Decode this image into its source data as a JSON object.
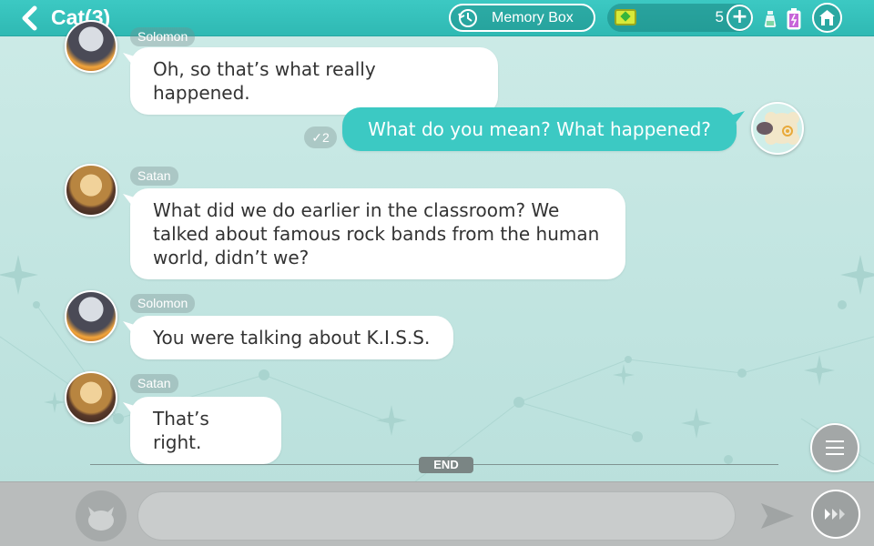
{
  "header": {
    "title": "Cat(3)",
    "memory_box_label": "Memory Box",
    "currency_count": "5",
    "plus_label": "+"
  },
  "messages": [
    {
      "sender": "Solomon",
      "text": "Oh, so that’s what really happened.",
      "side": "left"
    },
    {
      "sender": "",
      "text": "What do you mean? What happened?",
      "side": "right",
      "read_count": "✓2"
    },
    {
      "sender": "Satan",
      "text": "What did we do earlier in the classroom? We talked about famous rock bands from the human world, didn’t we?",
      "side": "left"
    },
    {
      "sender": "Solomon",
      "text": "You were talking about K.I.S.S.",
      "side": "left"
    },
    {
      "sender": "Satan",
      "text": "That’s right.",
      "side": "left"
    }
  ],
  "end_label": "END",
  "input": {
    "value": "",
    "placeholder": ""
  },
  "colors": {
    "accent": "#3cc9c3",
    "bubble_text": "#333333",
    "bar": "#b9bcbc"
  },
  "icons": [
    "back-icon",
    "clock-icon",
    "gem-icon",
    "plus-icon",
    "flask-icon",
    "battery-icon",
    "home-icon",
    "menu-icon",
    "cat-face-icon",
    "send-icon",
    "auto-play-icon"
  ]
}
